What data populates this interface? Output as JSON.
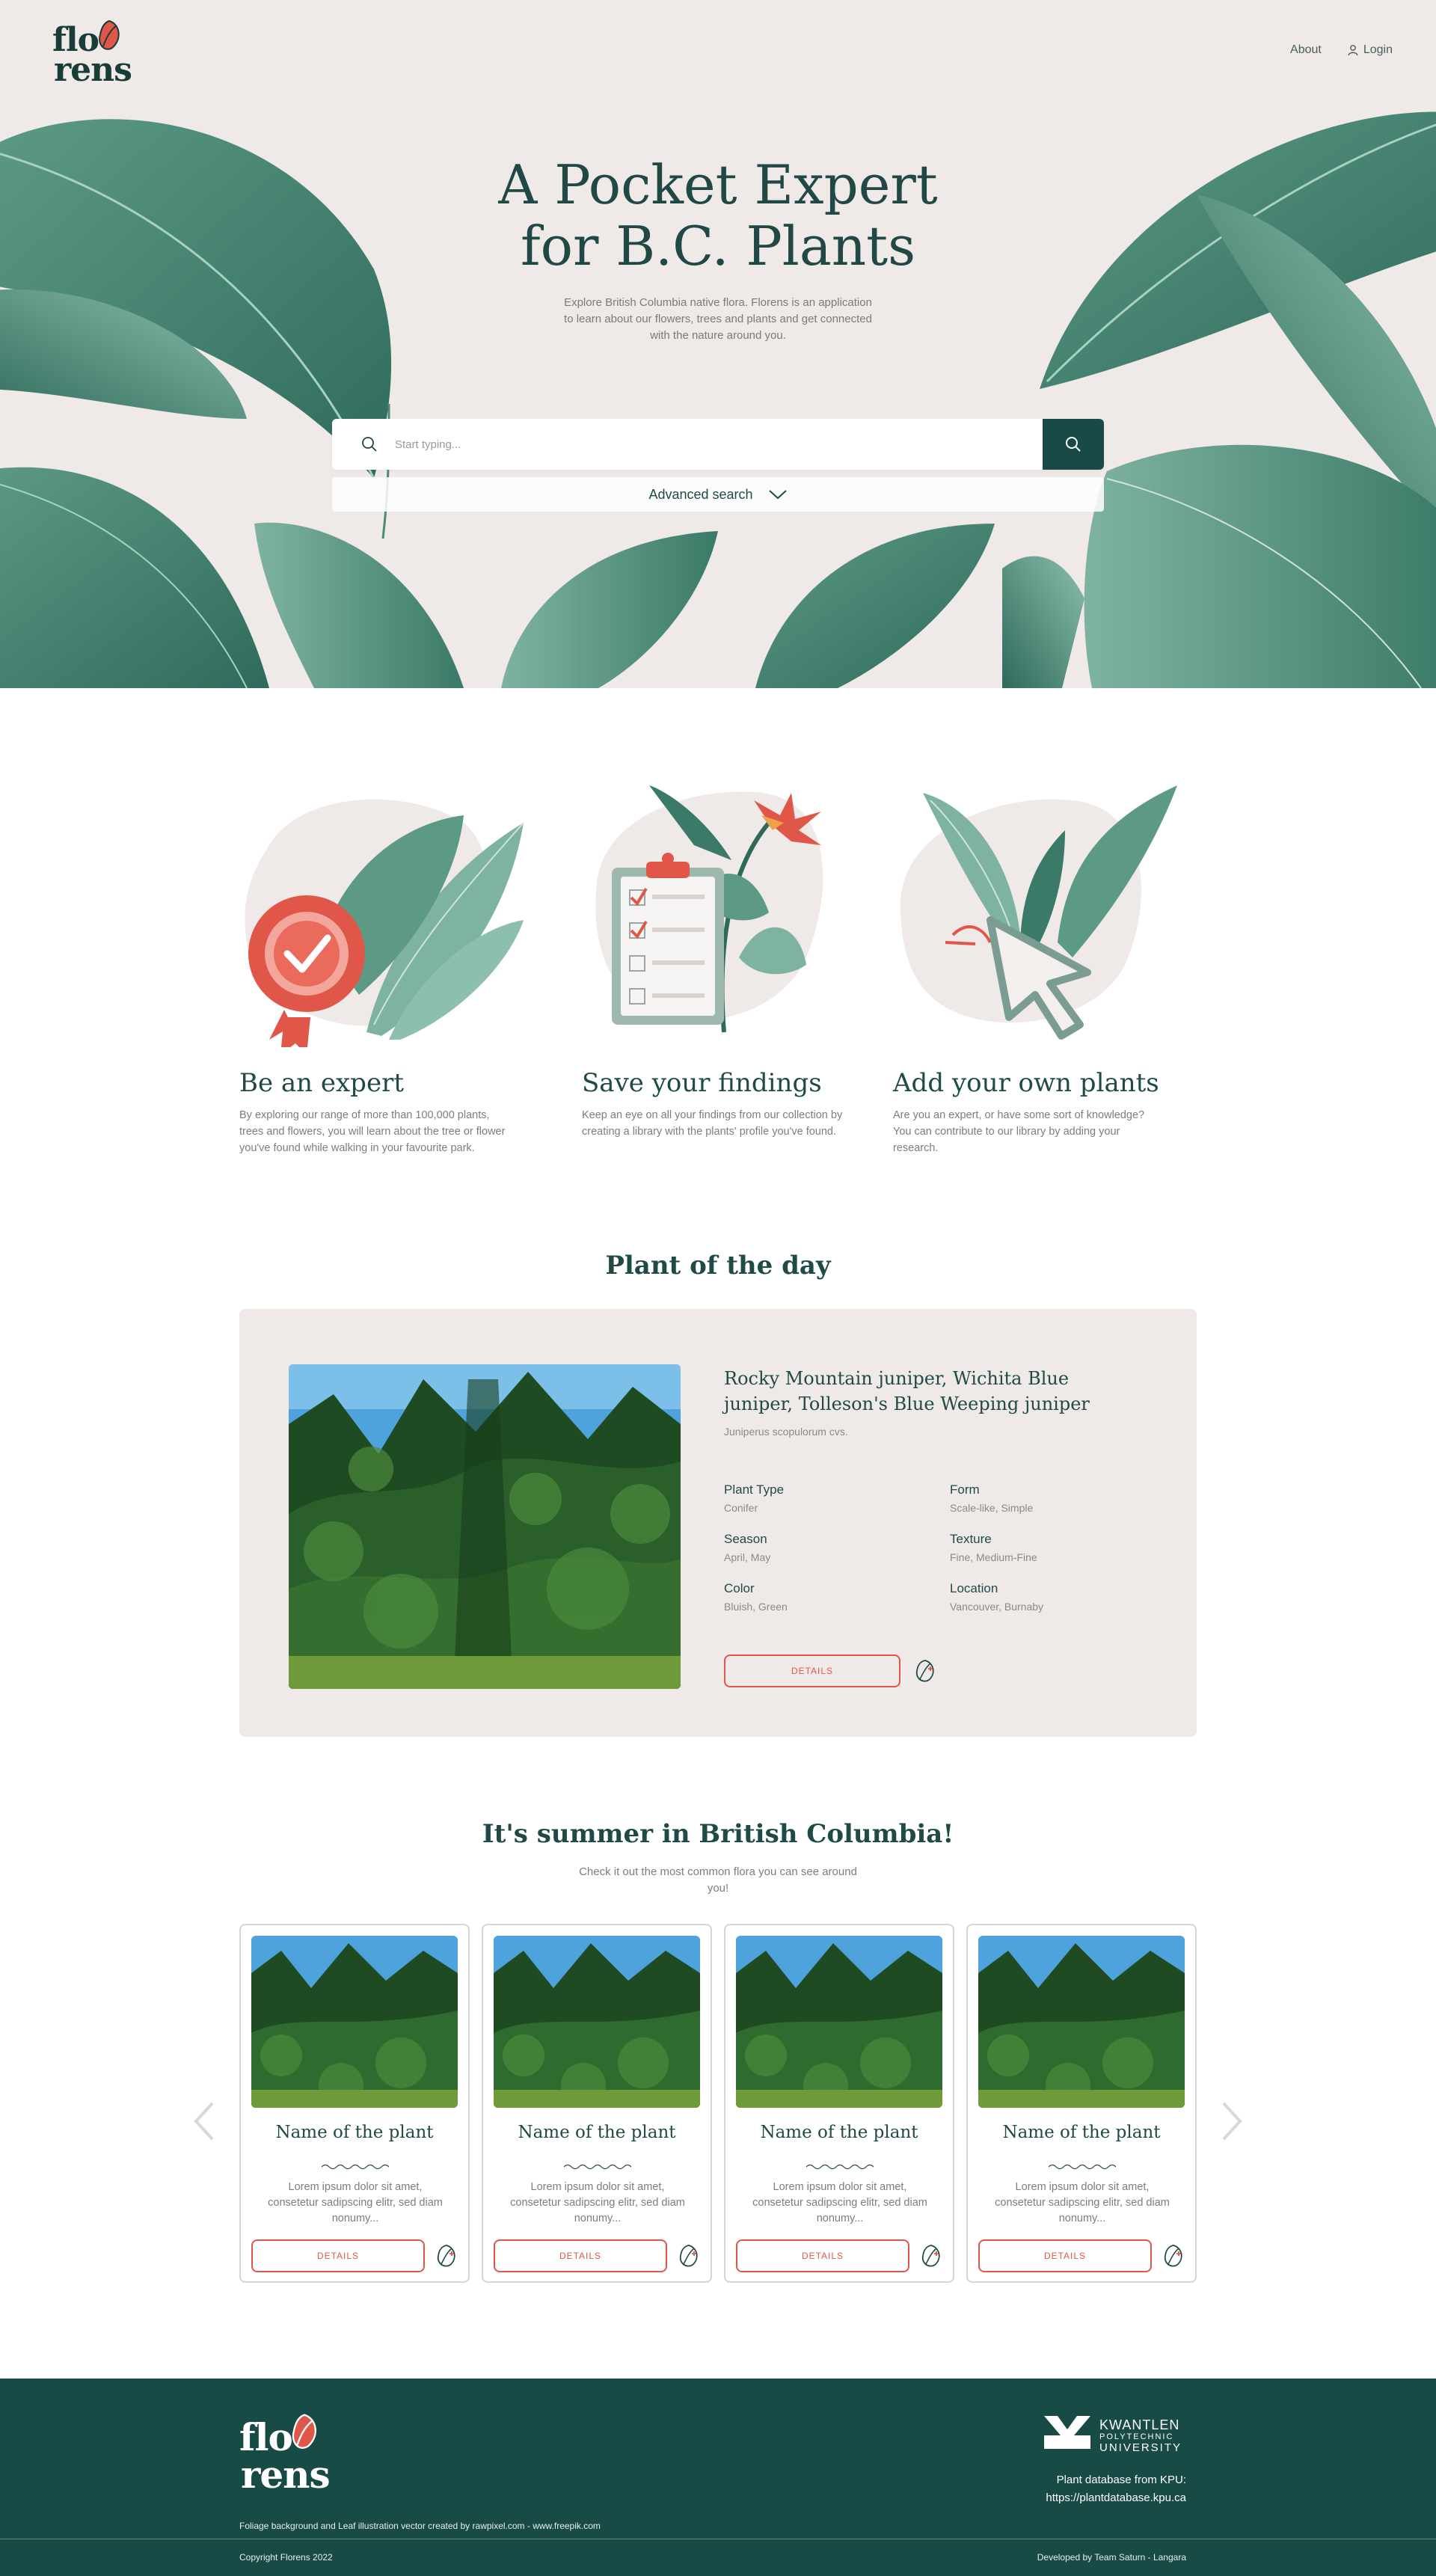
{
  "brand": {
    "logo_line1": "flo",
    "logo_line2": "rens"
  },
  "nav": {
    "about": "About",
    "login": "Login"
  },
  "hero": {
    "title_line1": "A Pocket Expert",
    "title_line2": "for B.C. Plants",
    "subtitle": "Explore British Columbia native flora. Florens is an application to learn about our flowers, trees and plants and get connected with the nature around you.",
    "search_placeholder": "Start typing...",
    "advanced_search": "Advanced search"
  },
  "features": [
    {
      "title": "Be an expert",
      "text": "By exploring our range of more than 100,000 plants, trees and flowers, you will learn about the tree or flower you've found while walking in your favourite park."
    },
    {
      "title": "Save your findings",
      "text": "Keep an eye on all your findings from our collection by creating a library with the plants' profile you've found."
    },
    {
      "title": "Add your own plants",
      "text": "Are you an expert, or have some sort of knowledge? You can contribute to our library by adding your research."
    }
  ],
  "plant_of_day": {
    "section_title": "Plant of the day",
    "name": "Rocky Mountain juniper, Wichita Blue juniper, Tolleson's Blue Weeping juniper",
    "latin": "Juniperus scopulorum cvs.",
    "attributes": [
      {
        "key": "Plant Type",
        "value": "Conifer"
      },
      {
        "key": "Form",
        "value": "Scale-like, Simple"
      },
      {
        "key": "Season",
        "value": "April, May"
      },
      {
        "key": "Texture",
        "value": "Fine, Medium-Fine"
      },
      {
        "key": "Color",
        "value": "Bluish, Green"
      },
      {
        "key": "Location",
        "value": "Vancouver, Burnaby"
      }
    ],
    "details_label": "DETAILS"
  },
  "summer": {
    "title": "It's summer in British Columbia!",
    "subtitle": "Check it out the most common flora you can see around you!",
    "cards": [
      {
        "title": "Name of the plant",
        "desc": "Lorem ipsum dolor sit amet, consetetur sadipscing elitr, sed diam nonumy...",
        "button": "DETAILS"
      },
      {
        "title": "Name of the plant",
        "desc": "Lorem ipsum dolor sit amet, consetetur sadipscing elitr, sed diam nonumy...",
        "button": "DETAILS"
      },
      {
        "title": "Name of the plant",
        "desc": "Lorem ipsum dolor sit amet, consetetur sadipscing elitr, sed diam nonumy...",
        "button": "DETAILS"
      },
      {
        "title": "Name of the plant",
        "desc": "Lorem ipsum dolor sit amet, consetetur sadipscing elitr, sed diam nonumy...",
        "button": "DETAILS"
      }
    ]
  },
  "footer": {
    "kpu_line1": "KWANTLEN",
    "kpu_line2": "POLYTECHNIC",
    "kpu_line3": "UNIVERSITY",
    "db_line1": "Plant database from KPU:",
    "db_line2": "https://plantdatabase.kpu.ca",
    "credit": "Foliage background and Leaf illustration vector created by rawpixel.com - www.freepik.com",
    "copyright": "Copyright Florens 2022",
    "developed": "Developed by Team Saturn - Langara"
  },
  "colors": {
    "primary": "#184a46",
    "accent": "#e0574a",
    "hero_bg": "#efe9e8",
    "text_muted": "#7d7d7d"
  },
  "icons": [
    "search-icon",
    "user-icon",
    "chevron-down-icon",
    "leaf-add-icon",
    "chevron-left-icon",
    "chevron-right-icon",
    "award-ribbon-icon",
    "clipboard-checklist-icon",
    "cursor-arrow-icon"
  ]
}
